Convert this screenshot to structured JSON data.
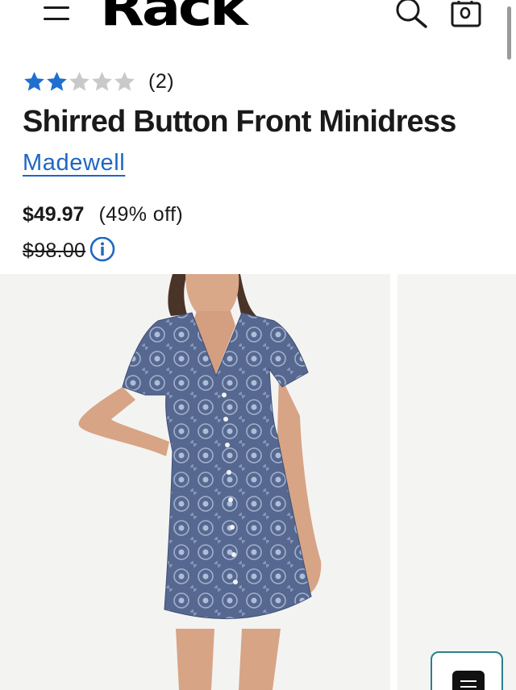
{
  "header": {
    "logo_text": "Rack",
    "menu_icon": "hamburger-menu-icon",
    "search_icon": "search-icon",
    "bag_icon": "shopping-bag-icon"
  },
  "product": {
    "rating": {
      "value": 2,
      "max": 5,
      "review_count": "(2)"
    },
    "title": "Shirred Button Front Minidress",
    "brand": "Madewell",
    "price": "$49.97",
    "discount": "(49% off)",
    "original_price": "$98.00"
  },
  "colors": {
    "star_filled": "#1f6fd1",
    "star_empty": "#c9c9c9",
    "brand_link": "#1f67c2",
    "fab_border": "#2a7f8c",
    "dress": "#56688f"
  },
  "fab": {
    "icon": "list-icon"
  }
}
